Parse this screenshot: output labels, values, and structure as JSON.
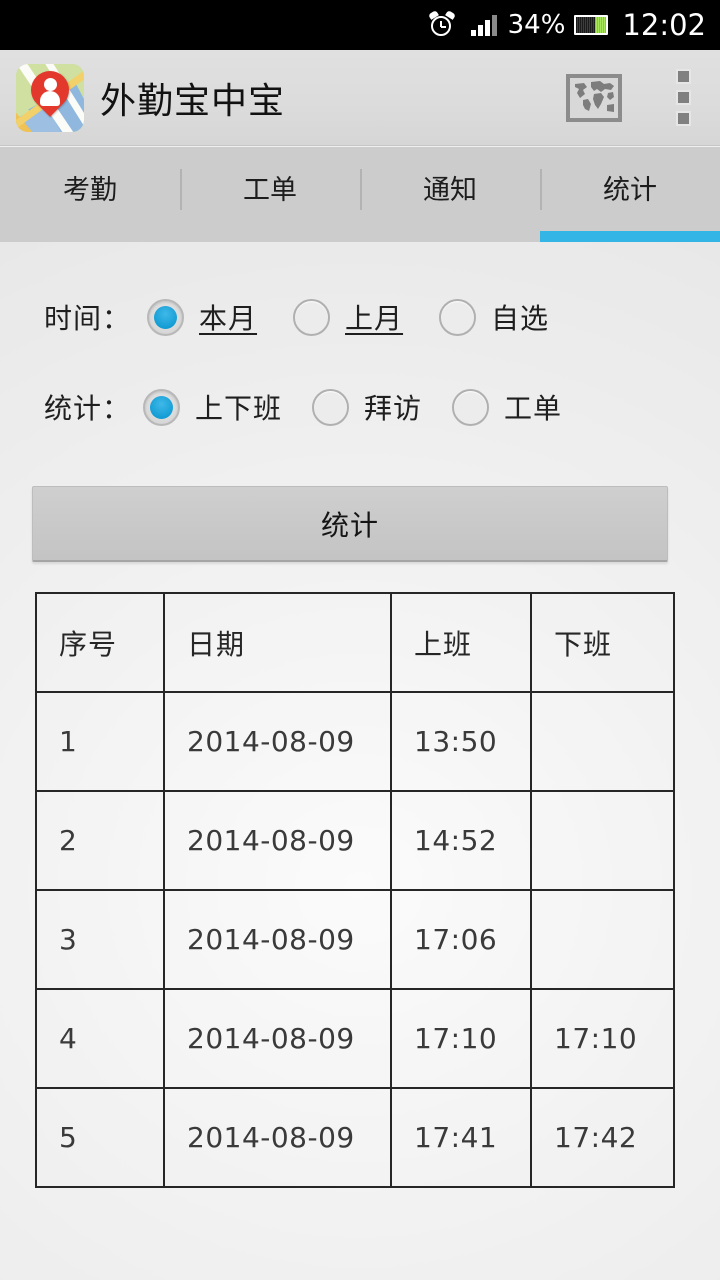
{
  "status_bar": {
    "alarm_icon": "alarm-clock-icon",
    "signal_icon": "signal-bars-icon",
    "battery_percent": "34%",
    "battery_icon": "battery-icon",
    "time": "12:02"
  },
  "action_bar": {
    "app_icon": "map-pin-app-icon",
    "title": "外勤宝中宝",
    "map_button_icon": "world-map-icon",
    "overflow_icon": "overflow-menu-icon"
  },
  "tabs": [
    {
      "label": "考勤",
      "active": false
    },
    {
      "label": "工单",
      "active": false
    },
    {
      "label": "通知",
      "active": false
    },
    {
      "label": "统计",
      "active": true
    }
  ],
  "filters": {
    "time": {
      "label": "时间：",
      "options": [
        {
          "label": "本月",
          "selected": true,
          "underlined": true
        },
        {
          "label": "上月",
          "selected": false,
          "underlined": true
        },
        {
          "label": "自选",
          "selected": false,
          "underlined": false
        }
      ]
    },
    "type": {
      "label": "统计：",
      "options": [
        {
          "label": "上下班",
          "selected": true,
          "underlined": false
        },
        {
          "label": "拜访",
          "selected": false,
          "underlined": false
        },
        {
          "label": "工单",
          "selected": false,
          "underlined": false
        }
      ]
    }
  },
  "stat_button": {
    "label": "统计"
  },
  "table": {
    "headers": [
      "序号",
      "日期",
      "上班",
      "下班"
    ],
    "rows": [
      {
        "index": "1",
        "date": "2014-08-09",
        "clock_in": "13:50",
        "clock_out": ""
      },
      {
        "index": "2",
        "date": "2014-08-09",
        "clock_in": "14:52",
        "clock_out": ""
      },
      {
        "index": "3",
        "date": "2014-08-09",
        "clock_in": "17:06",
        "clock_out": ""
      },
      {
        "index": "4",
        "date": "2014-08-09",
        "clock_in": "17:10",
        "clock_out": "17:10"
      },
      {
        "index": "5",
        "date": "2014-08-09",
        "clock_in": "17:41",
        "clock_out": "17:42"
      }
    ]
  },
  "colors": {
    "accent": "#33b5e5",
    "status_bar_bg": "#000000",
    "action_bar_bg": "#dcdcdc",
    "tab_bar_bg": "#cccccc",
    "content_bg": "#f2f2f2",
    "battery_green": "#7ed321",
    "pin_red": "#e2392c"
  }
}
